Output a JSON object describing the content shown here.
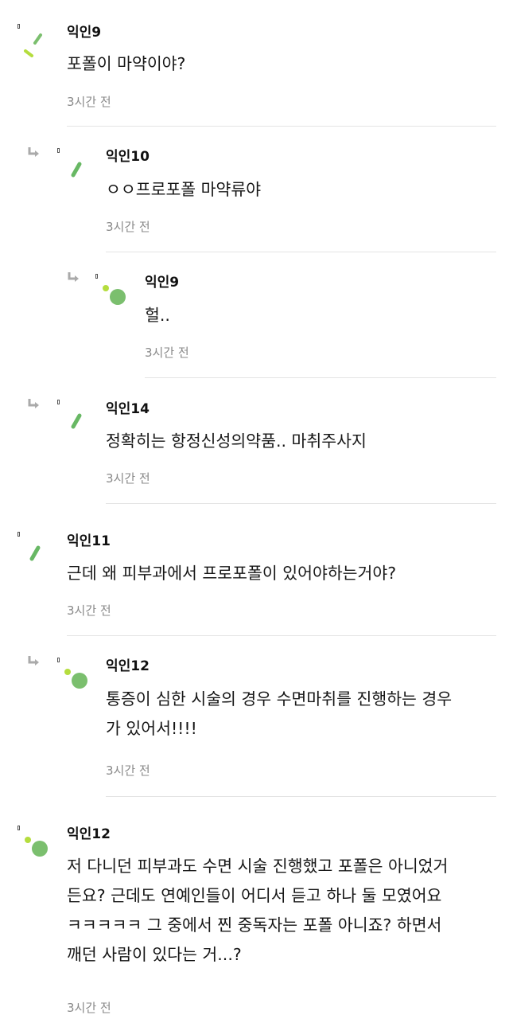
{
  "colors": {
    "avatar_green": "#7bbf6e",
    "avatar_lime": "#b5dd3e",
    "avatar_leaf": "#68b864",
    "time_gray": "#8a8a8a",
    "divider_gray": "#e4e4e4"
  },
  "comments": [
    {
      "author": "익인9",
      "lines": [
        "포폴이 마약이야?"
      ],
      "time": "3시간 전",
      "avatar": "stripe-slashes-icon"
    },
    {
      "author": "익인10",
      "lines": [
        "ㅇㅇ프로포폴 마약류야"
      ],
      "time": "3시간 전",
      "avatar": "stripe-slash-icon",
      "reply": true
    },
    {
      "author": "익인9",
      "lines": [
        "헐.."
      ],
      "time": "3시간 전",
      "avatar": "dot-circle-icon",
      "reply": true
    },
    {
      "author": "익인14",
      "lines": [
        "정확히는 항정신성의약품.. 마취주사지"
      ],
      "time": "3시간 전",
      "avatar": "stripe-slash-icon",
      "reply": true
    },
    {
      "author": "익인11",
      "lines": [
        "근데 왜 피부과에서 프로포폴이 있어야하는거야?"
      ],
      "time": "3시간 전",
      "avatar": "stripe-slash-icon"
    },
    {
      "author": "익인12",
      "lines": [
        "통증이 심한 시술의 경우 수면마취를 진행하는 경우",
        "가 있어서!!!!"
      ],
      "time": "3시간 전",
      "avatar": "dot-circle-icon",
      "reply": true
    },
    {
      "author": "익인12",
      "lines": [
        "저 다니던 피부과도 수면 시술 진행했고 포폴은 아니었거",
        "든요? 근데도 연예인들이 어디서 듣고 하나 둘 모였어요",
        "ㅋㅋㅋㅋㅋ 그 중에서 찐 중독자는 포폴 아니죠? 하면서",
        "깨던 사람이 있다는 거...?"
      ],
      "time": "3시간 전",
      "avatar": "dot-circle-icon"
    }
  ]
}
